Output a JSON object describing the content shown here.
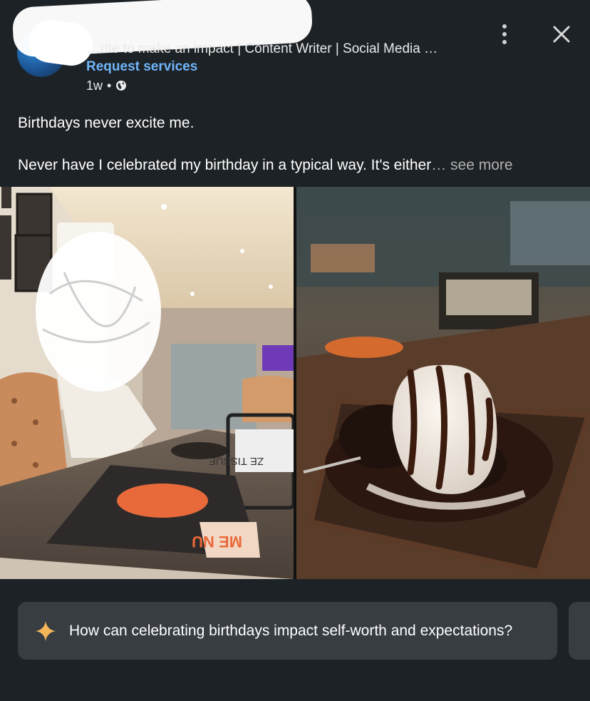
{
  "post": {
    "author_headline": "…rite to make an impact | Content Writer | Social Media …",
    "request_label": "Request services",
    "time_ago": "1w",
    "dot": "•",
    "paragraph1": "Birthdays never excite me.",
    "paragraph2": "Never have I celebrated my birthday in a typical way. It's either",
    "ellipsis": "…",
    "see_more": " see more"
  },
  "photos": {
    "left_menu_text": "ME NU",
    "left_tissue_text": "ZE TISSUE"
  },
  "suggestion": {
    "label": "How can celebrating birthdays impact self-worth and expectations?"
  },
  "colors": {
    "background": "#1d2226",
    "link": "#70b5f9",
    "chip": "#383d42",
    "sparkle": "#f5b65a"
  }
}
